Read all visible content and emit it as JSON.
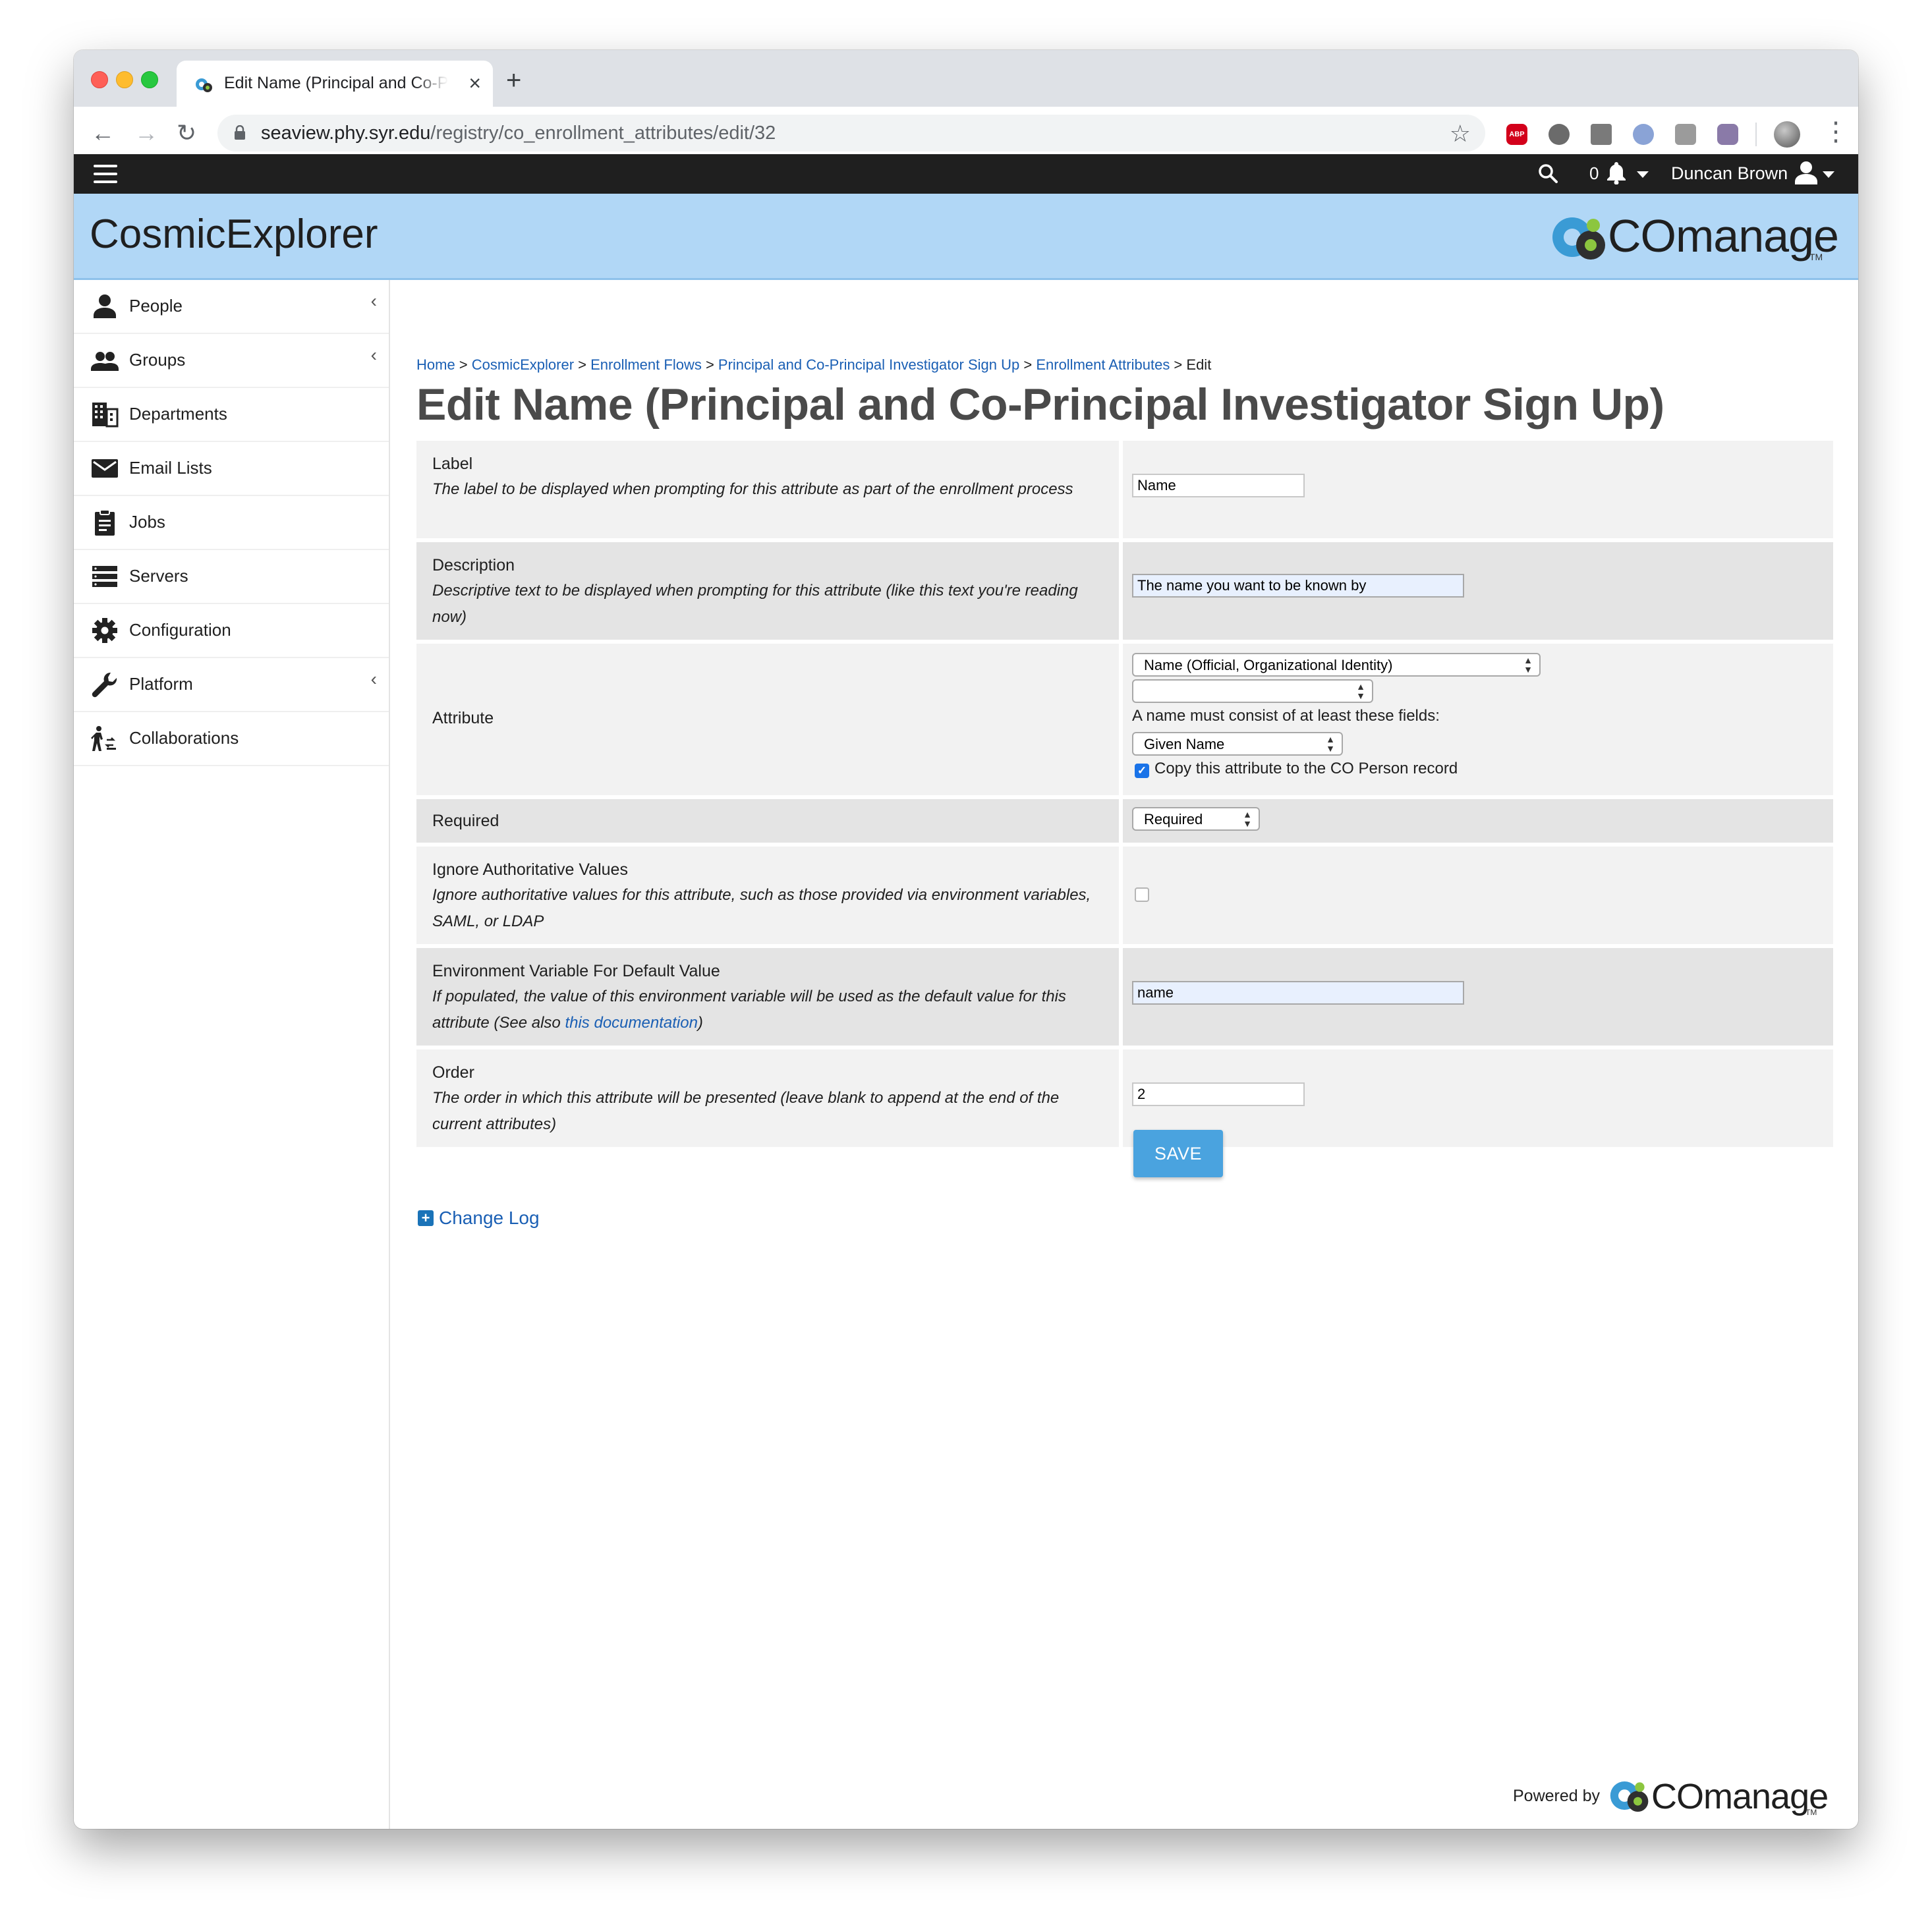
{
  "browser": {
    "tab_title": "Edit Name (Principal and Co-Principal Investigator Sign Up)",
    "tab_close": "×",
    "new_tab": "+",
    "url_host": "seaview.phy.syr.edu",
    "url_path": "/registry/co_enrollment_attributes/edit/32",
    "back": "←",
    "forward": "→",
    "reload": "↻",
    "bookmark_star": "☆",
    "menu": "⋮",
    "extension_abp": "ABP"
  },
  "topbar": {
    "notification_count": "0",
    "user_name": "Duncan Brown"
  },
  "banner": {
    "title": "CosmicExplorer",
    "brand": "COmanage",
    "tm": "TM"
  },
  "sidebar": {
    "items": [
      {
        "label": "People",
        "icon": "person-icon",
        "expandable": true
      },
      {
        "label": "Groups",
        "icon": "group-icon",
        "expandable": true
      },
      {
        "label": "Departments",
        "icon": "building-icon",
        "expandable": false
      },
      {
        "label": "Email Lists",
        "icon": "envelope-icon",
        "expandable": false
      },
      {
        "label": "Jobs",
        "icon": "clipboard-icon",
        "expandable": false
      },
      {
        "label": "Servers",
        "icon": "server-icon",
        "expandable": false
      },
      {
        "label": "Configuration",
        "icon": "gear-icon",
        "expandable": false
      },
      {
        "label": "Platform",
        "icon": "wrench-icon",
        "expandable": true
      },
      {
        "label": "Collaborations",
        "icon": "collaborations-icon",
        "expandable": false
      }
    ],
    "chevron": "‹"
  },
  "breadcrumb": {
    "home": "Home",
    "co": "CosmicExplorer",
    "flows": "Enrollment Flows",
    "flow": "Principal and Co-Principal Investigator Sign Up",
    "attributes": "Enrollment Attributes",
    "current": "Edit",
    "sep": " > "
  },
  "page_title": "Edit Name (Principal and Co-Principal Investigator Sign Up)",
  "form": {
    "label": {
      "name": "Label",
      "desc": "The label to be displayed when prompting for this attribute as part of the enrollment process",
      "value": "Name"
    },
    "description": {
      "name": "Description",
      "desc": "Descriptive text to be displayed when prompting for this attribute (like this text you're reading now)",
      "value": "The name you want to be known by"
    },
    "attribute": {
      "name": "Attribute",
      "select_value": "Name (Official, Organizational Identity)",
      "second_select_value": "",
      "help": "A name must consist of at least these fields:",
      "fields_select_value": "Given Name",
      "copy_label": "Copy this attribute to the CO Person record",
      "copy_checked": true
    },
    "required": {
      "name": "Required",
      "value": "Required"
    },
    "ignore_authoritative": {
      "name": "Ignore Authoritative Values",
      "desc": "Ignore authoritative values for this attribute, such as those provided via environment variables, SAML, or LDAP",
      "checked": false
    },
    "env_variable": {
      "name": "Environment Variable For Default Value",
      "desc_prefix": "If populated, the value of this environment variable will be used as the default value for this attribute (See also ",
      "link": "this documentation",
      "desc_suffix": ")",
      "value": "name"
    },
    "order": {
      "name": "Order",
      "desc": "The order in which this attribute will be presented (leave blank to append at the end of the current attributes)",
      "value": "2"
    },
    "save_label": "SAVE"
  },
  "changelog": {
    "icon": "+",
    "label": "Change Log"
  },
  "footer": {
    "powered_by": "Powered by",
    "brand": "COmanage",
    "tm": "TM"
  },
  "colors": {
    "banner": "#b1d7f6",
    "topbar": "#1f1f1f",
    "link": "#1a5fb4",
    "save_button": "#4aa3df"
  }
}
